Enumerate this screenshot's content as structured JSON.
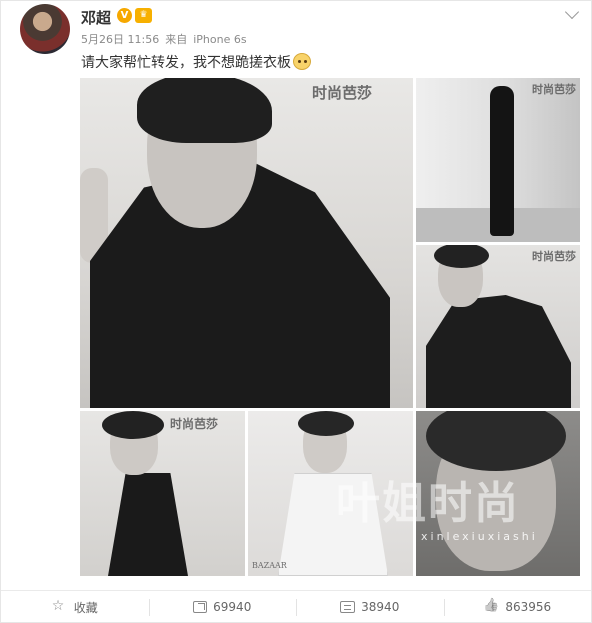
{
  "post": {
    "username": "邓超",
    "timestamp": "5月26日 11:56",
    "source_prefix": "来自",
    "source_device": "iPhone 6s",
    "text": "请大家帮忙转发，我不想跪搓衣板",
    "verified_icon": "verified-v-badge",
    "member_icon": "vip-member-badge",
    "emoji_icon": "doge-emoji"
  },
  "images": {
    "magazine_logo": "时尚芭莎",
    "magazine_logo_small": "BAZAAR",
    "watermark": "叶姐时尚",
    "watermark_sub": "xinlexiuxiashi"
  },
  "actions": {
    "favorite_label": "收藏",
    "repost_count": "69940",
    "comment_count": "38940",
    "like_count": "863956"
  },
  "colors": {
    "badge_orange": "#f6a800",
    "text_dark": "#333333",
    "text_meta": "#8a8a8a"
  }
}
